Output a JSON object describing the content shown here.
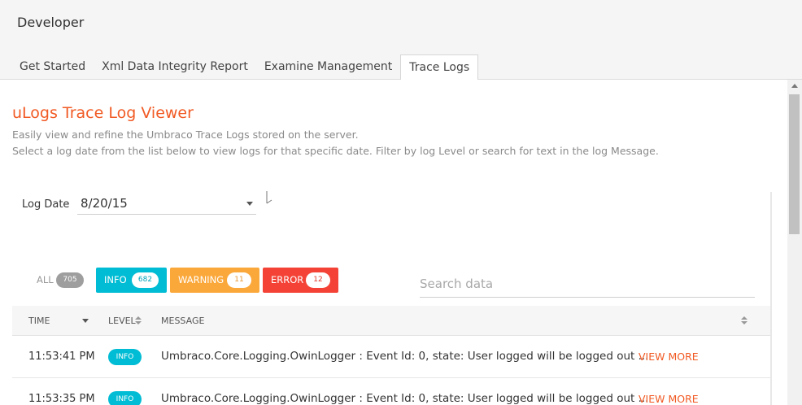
{
  "app": {
    "title": "Developer"
  },
  "tabs": [
    {
      "label": "Get Started"
    },
    {
      "label": "Xml Data Integrity Report"
    },
    {
      "label": "Examine Management"
    },
    {
      "label": "Trace Logs",
      "active": true
    }
  ],
  "page": {
    "title": "uLogs Trace Log Viewer",
    "description_line1": "Easily view and refine the Umbraco Trace Logs stored on the server.",
    "description_line2": "Select a log date from the list below to view logs for that specific date. Filter by log Level or search for text in the log Message."
  },
  "log_date": {
    "label": "Log Date",
    "value": "8/20/15"
  },
  "filters": {
    "all": {
      "label": "ALL",
      "count": "705"
    },
    "info": {
      "label": "INFO",
      "count": "682",
      "color": "#00bcd4"
    },
    "warning": {
      "label": "WARNING",
      "count": "11",
      "color": "#fba83b"
    },
    "error": {
      "label": "ERROR",
      "count": "12",
      "color": "#f44336"
    }
  },
  "search": {
    "placeholder": "Search data",
    "value": ""
  },
  "table": {
    "columns": {
      "time": "TIME",
      "level": "LEVEL",
      "message": "MESSAGE"
    },
    "rows": [
      {
        "time": "11:53:41 PM",
        "level": "INFO",
        "message": "Umbraco.Core.Logging.OwinLogger : Event Id: 0, state: User logged will be logged out ...",
        "action": "VIEW MORE"
      },
      {
        "time": "11:53:35 PM",
        "level": "INFO",
        "message": "Umbraco.Core.Logging.OwinLogger : Event Id: 0, state: User logged will be logged out ...",
        "action": "VIEW MORE"
      }
    ]
  },
  "colors": {
    "accent": "#f15a24",
    "info": "#00bcd4",
    "warning": "#fba83b",
    "error": "#f44336"
  }
}
